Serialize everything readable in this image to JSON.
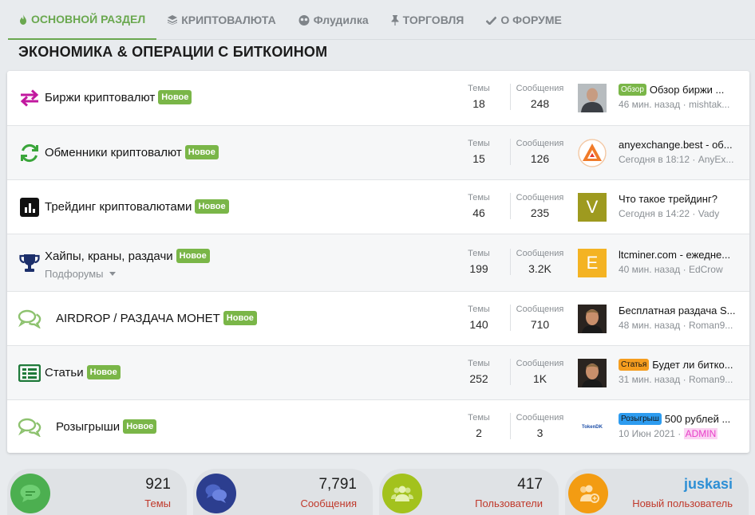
{
  "tabs": [
    {
      "label": "ОСНОВНОЙ РАЗДЕЛ",
      "icon": "flame-icon",
      "active": true
    },
    {
      "label": "КРИПТОВАЛЮТА",
      "icon": "layers-icon",
      "active": false
    },
    {
      "label": "Флудилка",
      "icon": "mask-icon",
      "active": false
    },
    {
      "label": "ТОРГОВЛЯ",
      "icon": "pin-icon",
      "active": false
    },
    {
      "label": "О ФОРУМЕ",
      "icon": "check-icon",
      "active": false
    }
  ],
  "section_title": "ЭКОНОМИКА & ОПЕРАЦИИ С БИТКОИНОМ",
  "labels": {
    "themes": "Темы",
    "messages": "Сообщения",
    "new": "Новое",
    "subforums": "Подфорумы"
  },
  "forums": [
    {
      "title": "Биржи криптовалют",
      "icon": "exchange-arrows-icon",
      "themes": "18",
      "messages": "248",
      "last_prefix": "Обзор",
      "last_title": "Обзор биржи ...",
      "last_time": "46 мин. назад",
      "last_user": "mishtak..."
    },
    {
      "title": "Обменники криптовалют",
      "icon": "refresh-icon",
      "themes": "15",
      "messages": "126",
      "last_prefix": "",
      "last_title": "anyexchange.best - об...",
      "last_time": "Сегодня в 18:12",
      "last_user": "AnyEx..."
    },
    {
      "title": "Трейдинг криптовалютами",
      "icon": "bar-chart-icon",
      "themes": "46",
      "messages": "235",
      "last_prefix": "",
      "last_title": "Что такое трейдинг?",
      "last_time": "Сегодня в 14:22",
      "last_user": "Vady",
      "avatar_letter": "V"
    },
    {
      "title": "Хайпы, краны, раздачи",
      "icon": "trophy-icon",
      "themes": "199",
      "messages": "3.2K",
      "last_prefix": "",
      "last_title": "ltcminer.com - ежедне...",
      "last_time": "40 мин. назад",
      "last_user": "EdCrow",
      "avatar_letter": "E"
    },
    {
      "title": "AIRDROP / РАЗДАЧА МОНЕТ",
      "icon": "chat-bubbles-icon",
      "themes": "140",
      "messages": "710",
      "last_prefix": "",
      "last_title": "Бесплатная раздача S...",
      "last_time": "48 мин. назад",
      "last_user": "Roman9..."
    },
    {
      "title": "Статьи",
      "icon": "newspaper-icon",
      "themes": "252",
      "messages": "1K",
      "last_prefix": "Статья",
      "last_title": "Будет ли битко...",
      "last_time": "31 мин. назад",
      "last_user": "Roman9..."
    },
    {
      "title": "Розыгрыши",
      "icon": "chat-bubbles-icon",
      "themes": "2",
      "messages": "3",
      "last_prefix": "Розыгрыш",
      "last_title": "500 рублей ...",
      "last_time": "10 Июн 2021",
      "last_user": "ADMIN",
      "avatar_text": "TokenDK"
    }
  ],
  "footer_stats": [
    {
      "value": "921",
      "label": "Темы",
      "icon": "comment-icon",
      "color": "#4caf50"
    },
    {
      "value": "7,791",
      "label": "Сообщения",
      "icon": "comments-icon",
      "color": "#2c3e8f"
    },
    {
      "value": "417",
      "label": "Пользователи",
      "icon": "users-icon",
      "color": "#a3c21d"
    },
    {
      "value": "juskasi",
      "label": "Новый пользователь",
      "icon": "user-add-icon",
      "color": "#f39c12"
    }
  ],
  "colors": {
    "accent": "#6aa84f",
    "badge_new": "#7ab648",
    "admin": "#e83fc8"
  }
}
